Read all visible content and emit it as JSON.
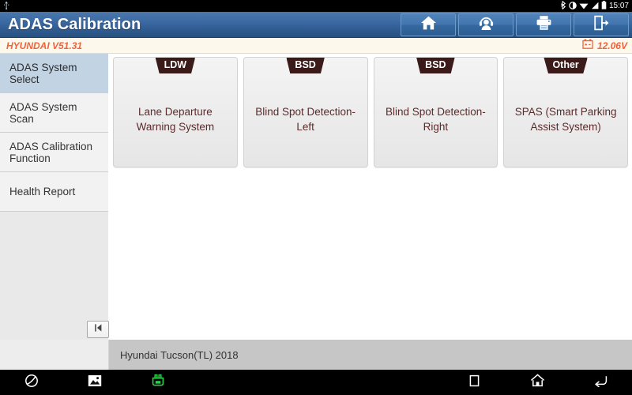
{
  "statusbar": {
    "usb_icon": "usb-icon",
    "bluetooth_icon": "bluetooth-icon",
    "dnd_icon": "do-not-disturb-icon",
    "wifi_icon": "wifi-icon",
    "signal_icon": "cellular-signal-icon",
    "battery_icon": "battery-icon",
    "time": "15:07"
  },
  "titlebar": {
    "title": "ADAS Calibration",
    "buttons": [
      {
        "name": "home-button",
        "icon": "home-icon"
      },
      {
        "name": "support-button",
        "icon": "headset-person-icon"
      },
      {
        "name": "print-button",
        "icon": "printer-icon"
      },
      {
        "name": "exit-button",
        "icon": "exit-door-icon"
      }
    ]
  },
  "versionbar": {
    "version_text": "HYUNDAI V51.31",
    "voltage": "12.06V",
    "battery_icon": "car-battery-icon",
    "accent_color": "#f0633c"
  },
  "sidebar": {
    "items": [
      {
        "label": "ADAS System Select",
        "selected": true
      },
      {
        "label": "ADAS System Scan",
        "selected": false
      },
      {
        "label": "ADAS Calibration Function",
        "selected": false
      },
      {
        "label": "Health Report",
        "selected": false
      }
    ],
    "collapse_icon": "collapse-panel-icon"
  },
  "main": {
    "cards": [
      {
        "badge": "LDW",
        "label": "Lane Departure Warning System"
      },
      {
        "badge": "BSD",
        "label": "Blind Spot Detection-Left"
      },
      {
        "badge": "BSD",
        "label": "Blind Spot Detection-Right"
      },
      {
        "badge": "Other",
        "label": "SPAS (Smart Parking Assist System)"
      }
    ],
    "badge_color": "#3b1a1a",
    "label_color": "#5c2b2b"
  },
  "vehiclebar": {
    "vehicle": "Hyundai Tucson(TL) 2018"
  },
  "navbar": {
    "items": [
      {
        "name": "browser-nav-icon",
        "icon": "globe-icon"
      },
      {
        "name": "gallery-nav-icon",
        "icon": "image-icon"
      },
      {
        "name": "vci-nav-icon",
        "icon": "vci-connector-icon"
      },
      {
        "name": "recents-nav-icon",
        "icon": "square-recents-icon"
      },
      {
        "name": "home-nav-icon",
        "icon": "home-outline-icon"
      },
      {
        "name": "back-nav-icon",
        "icon": "back-arrow-icon"
      }
    ],
    "vci_color": "#2bd14a"
  }
}
